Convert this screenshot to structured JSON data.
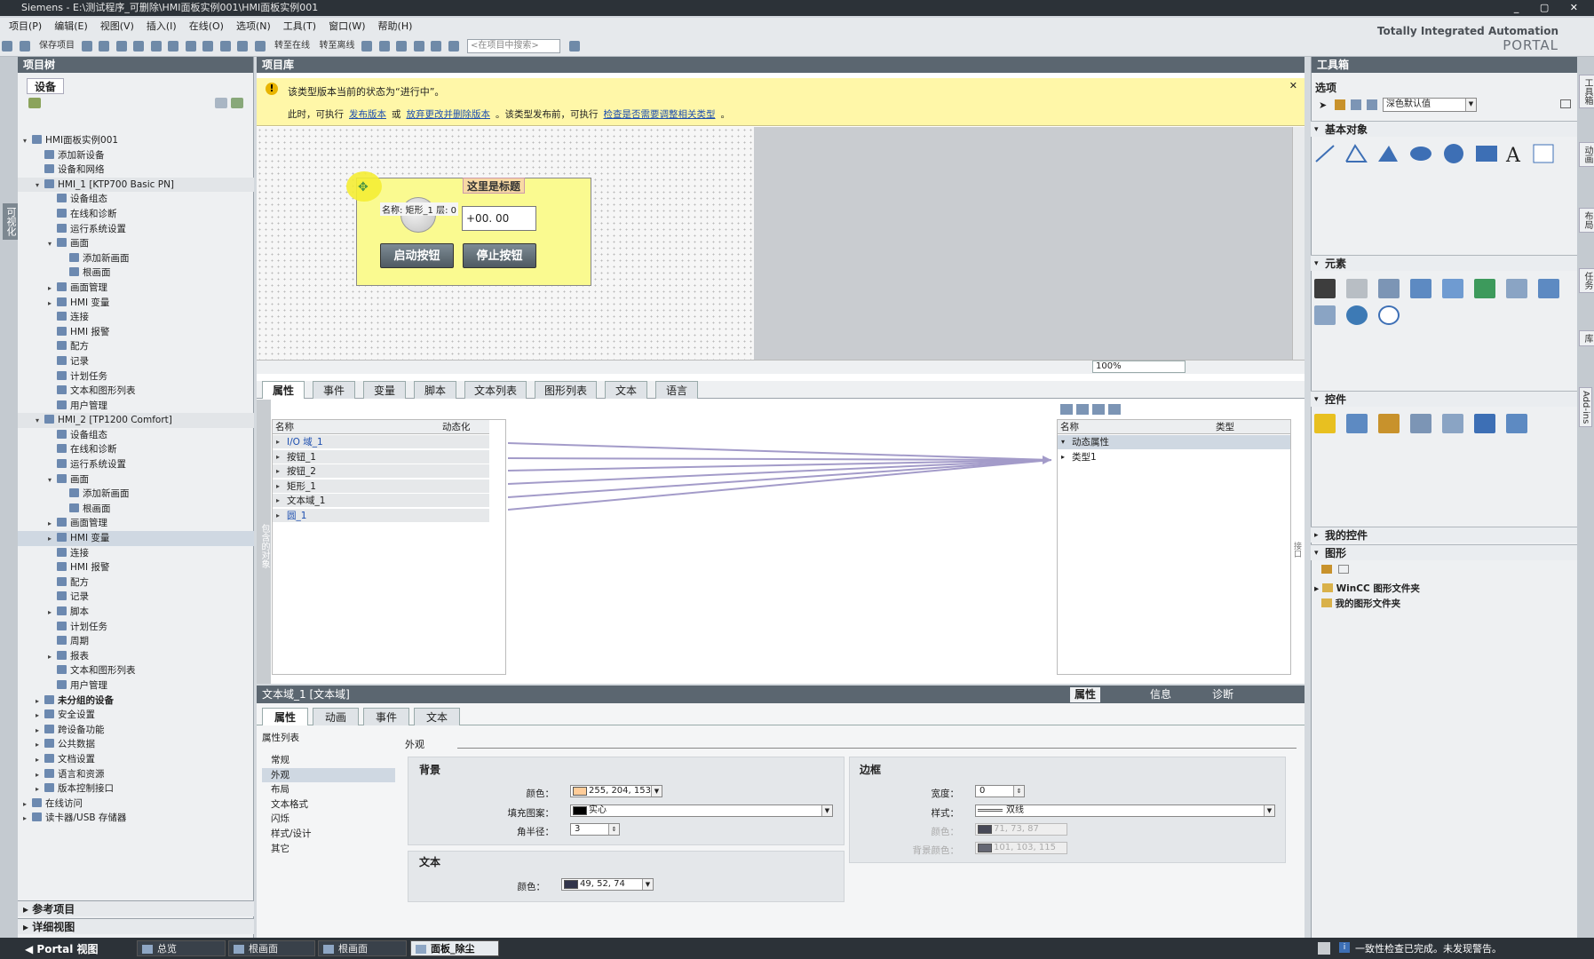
{
  "titlebar": {
    "text": "Siemens  -  E:\\测试程序_可删除\\HMI面板实例001\\HMI面板实例001",
    "controls": "_ ▢ ✕"
  },
  "menu": [
    "项目(P)",
    "编辑(E)",
    "视图(V)",
    "插入(I)",
    "在线(O)",
    "选项(N)",
    "工具(T)",
    "窗口(W)",
    "帮助(H)"
  ],
  "toolbar": {
    "save_label": "保存项目",
    "go_online": "转至在线",
    "go_offline": "转至离线",
    "search_placeholder": "<在项目中搜索>"
  },
  "brand": {
    "line1": "Totally Integrated Automation",
    "line2": "PORTAL"
  },
  "leftbar": {
    "label": "可视化"
  },
  "project_tree": {
    "title": "项目树",
    "tab": "设备",
    "rows": [
      {
        "lvl": 0,
        "arr": "▾",
        "text": "HMI面板实例001"
      },
      {
        "lvl": 1,
        "arr": "",
        "text": "添加新设备"
      },
      {
        "lvl": 1,
        "arr": "",
        "text": "设备和网络"
      },
      {
        "lvl": 1,
        "arr": "▾",
        "text": "HMI_1 [KTP700 Basic PN]",
        "cls": "grey"
      },
      {
        "lvl": 2,
        "arr": "",
        "text": "设备组态"
      },
      {
        "lvl": 2,
        "arr": "",
        "text": "在线和诊断"
      },
      {
        "lvl": 2,
        "arr": "",
        "text": "运行系统设置"
      },
      {
        "lvl": 2,
        "arr": "▾",
        "text": "画面"
      },
      {
        "lvl": 3,
        "arr": "",
        "text": "添加新画面"
      },
      {
        "lvl": 3,
        "arr": "",
        "text": "根画面"
      },
      {
        "lvl": 2,
        "arr": "▸",
        "text": "画面管理"
      },
      {
        "lvl": 2,
        "arr": "▸",
        "text": "HMI 变量"
      },
      {
        "lvl": 2,
        "arr": "",
        "text": "连接"
      },
      {
        "lvl": 2,
        "arr": "",
        "text": "HMI 报警"
      },
      {
        "lvl": 2,
        "arr": "",
        "text": "配方"
      },
      {
        "lvl": 2,
        "arr": "",
        "text": "记录"
      },
      {
        "lvl": 2,
        "arr": "",
        "text": "计划任务"
      },
      {
        "lvl": 2,
        "arr": "",
        "text": "文本和图形列表"
      },
      {
        "lvl": 2,
        "arr": "",
        "text": "用户管理"
      },
      {
        "lvl": 1,
        "arr": "▾",
        "text": "HMI_2 [TP1200 Comfort]",
        "cls": "grey"
      },
      {
        "lvl": 2,
        "arr": "",
        "text": "设备组态"
      },
      {
        "lvl": 2,
        "arr": "",
        "text": "在线和诊断"
      },
      {
        "lvl": 2,
        "arr": "",
        "text": "运行系统设置"
      },
      {
        "lvl": 2,
        "arr": "▾",
        "text": "画面"
      },
      {
        "lvl": 3,
        "arr": "",
        "text": "添加新画面"
      },
      {
        "lvl": 3,
        "arr": "",
        "text": "根画面"
      },
      {
        "lvl": 2,
        "arr": "▸",
        "text": "画面管理"
      },
      {
        "lvl": 2,
        "arr": "▸",
        "text": "HMI 变量",
        "cls": "sel"
      },
      {
        "lvl": 2,
        "arr": "",
        "text": "连接"
      },
      {
        "lvl": 2,
        "arr": "",
        "text": "HMI 报警"
      },
      {
        "lvl": 2,
        "arr": "",
        "text": "配方"
      },
      {
        "lvl": 2,
        "arr": "",
        "text": "记录"
      },
      {
        "lvl": 2,
        "arr": "▸",
        "text": "脚本"
      },
      {
        "lvl": 2,
        "arr": "",
        "text": "计划任务"
      },
      {
        "lvl": 2,
        "arr": "",
        "text": "周期"
      },
      {
        "lvl": 2,
        "arr": "▸",
        "text": "报表"
      },
      {
        "lvl": 2,
        "arr": "",
        "text": "文本和图形列表"
      },
      {
        "lvl": 2,
        "arr": "",
        "text": "用户管理"
      },
      {
        "lvl": 1,
        "arr": "▸",
        "text": "未分组的设备",
        "cls": "bold"
      },
      {
        "lvl": 1,
        "arr": "▸",
        "text": "安全设置"
      },
      {
        "lvl": 1,
        "arr": "▸",
        "text": "跨设备功能"
      },
      {
        "lvl": 1,
        "arr": "▸",
        "text": "公共数据"
      },
      {
        "lvl": 1,
        "arr": "▸",
        "text": "文档设置"
      },
      {
        "lvl": 1,
        "arr": "▸",
        "text": "语言和资源"
      },
      {
        "lvl": 1,
        "arr": "▸",
        "text": "版本控制接口"
      },
      {
        "lvl": 0,
        "arr": "▸",
        "text": "在线访问"
      },
      {
        "lvl": 0,
        "arr": "▸",
        "text": "读卡器/USB 存储器"
      }
    ],
    "ref_projects": "参考项目",
    "detail_view": "详细视图"
  },
  "library": {
    "title": "项目库",
    "warning_line1": "该类型版本当前的状态为“进行中”。",
    "warning_line2_a": "此时，可执行",
    "warning_link1": "发布版本",
    "warning_or": "或",
    "warning_link2": "放弃更改并删除版本",
    "warning_line2_b": "。该类型发布前，可执行",
    "warning_link3": "检查是否需要调整相关类型",
    "warning_end": "。",
    "zoom": "100%"
  },
  "faceplate": {
    "title": "这里是标题",
    "name_label": "名称: 矩形_1   层: 0",
    "io_value": "+00. 00",
    "start_button": "启动按钮",
    "stop_button": "停止按钮"
  },
  "lib_tabs": [
    "属性",
    "事件",
    "变量",
    "脚本",
    "文本列表",
    "图形列表",
    "文本",
    "语言"
  ],
  "contained_label": "包含的对象",
  "left_table": {
    "col_name": "名称",
    "col_dyn": "动态化",
    "rows": [
      "I/O 域_1",
      "按钮_1",
      "按钮_2",
      "矩形_1",
      "文本域_1",
      "圆_1"
    ]
  },
  "right_table": {
    "col_name": "名称",
    "col_type": "类型",
    "rows": [
      {
        "arr": "▾",
        "text": "动态属性"
      },
      {
        "arr": "▸",
        "text": "类型1"
      }
    ]
  },
  "interface_label": "接口",
  "props": {
    "title": "文本域_1 [文本域]",
    "head_tabs": [
      "属性",
      "信息",
      "诊断"
    ],
    "tabs": [
      "属性",
      "动画",
      "事件",
      "文本"
    ],
    "list_title": "属性列表",
    "list": [
      "常规",
      "外观",
      "布局",
      "文本格式",
      "闪烁",
      "样式/设计",
      "其它"
    ],
    "section": "外观",
    "background": {
      "title": "背景",
      "color_label": "颜色：",
      "color_value": "255, 204, 153",
      "color_hex": "#ffcc99",
      "fill_label": "填充图案：",
      "fill_value": "实心",
      "radius_label": "角半径：",
      "radius_value": "3"
    },
    "border": {
      "title": "边框",
      "width_label": "宽度：",
      "width_value": "0",
      "style_label": "样式：",
      "style_value": "双线",
      "color_label": "颜色：",
      "color_value": "71, 73, 87",
      "bgcolor_label": "背景颜色：",
      "bgcolor_value": "101, 103, 115"
    },
    "text": {
      "title": "文本",
      "color_label": "颜色：",
      "color_value": "49, 52, 74"
    }
  },
  "toolbox": {
    "title": "工具箱",
    "options": "选项",
    "style_value": "深色默认值",
    "sections": [
      "基本对象",
      "元素",
      "控件",
      "我的控件",
      "图形"
    ],
    "folder1": "WinCC 图形文件夹",
    "folder2": "我的图形文件夹"
  },
  "rightbar": [
    "工具箱",
    "动画",
    "布局",
    "任务",
    "库",
    "Add-ins"
  ],
  "statusbar": {
    "portal": "◀  Portal 视图",
    "tabs": [
      "总览",
      "根画面",
      "根画面",
      "面板_除尘"
    ],
    "message": "一致性检查已完成。未发现警告。"
  }
}
